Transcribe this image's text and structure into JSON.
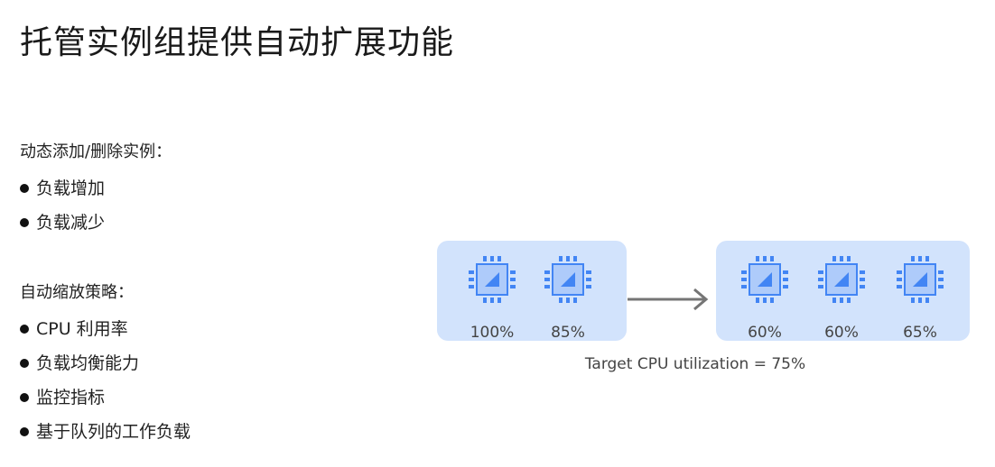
{
  "slide": {
    "title": "托管实例组提供自动扩展功能"
  },
  "dynamic_section": {
    "heading": "动态添加/删除实例：",
    "bullets": [
      "负载增加",
      "负载减少"
    ]
  },
  "autoscale_section": {
    "heading": "自动缩放策略：",
    "bullets": [
      "CPU 利用率",
      "负载均衡能力",
      "监控指标",
      "基于队列的工作负载"
    ]
  },
  "diagram": {
    "before": {
      "instances": [
        "100%",
        "85%"
      ]
    },
    "after": {
      "instances": [
        "60%",
        "60%",
        "65%"
      ]
    },
    "caption": "Target CPU utilization = 75%",
    "colors": {
      "panel": "#d2e3fc",
      "chip": "#4285f4",
      "chip_light": "#aecbfa",
      "arrow": "#757575"
    },
    "icon": "cpu-chip-icon"
  }
}
